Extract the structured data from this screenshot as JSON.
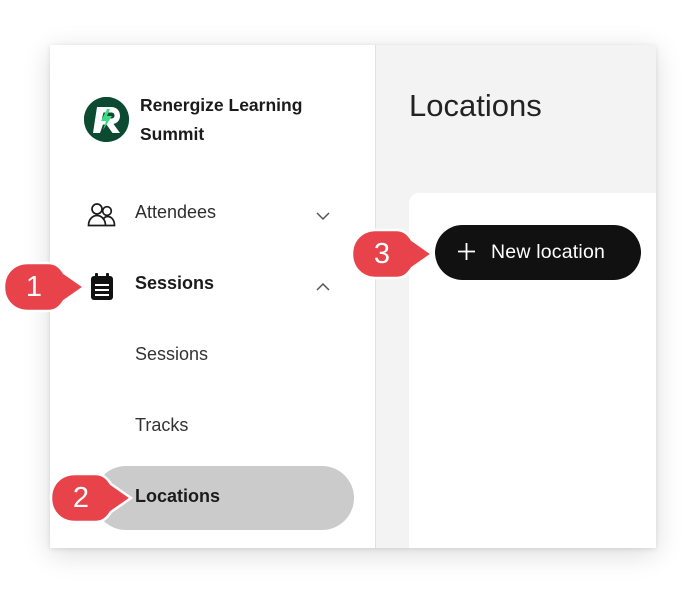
{
  "app": {
    "name": "Renergize Learning Summit"
  },
  "sidebar": {
    "attendees": {
      "label": "Attendees",
      "icon": "people-icon",
      "expanded": false
    },
    "sessions": {
      "label": "Sessions",
      "icon": "calendar-icon",
      "expanded": true,
      "sub_items": [
        {
          "label": "Sessions",
          "active": false
        },
        {
          "label": "Tracks",
          "active": false
        },
        {
          "label": "Locations",
          "active": true
        }
      ]
    }
  },
  "main": {
    "title": "Locations",
    "new_button": {
      "label": "New location",
      "icon": "plus-icon"
    }
  },
  "callouts": [
    "1",
    "2",
    "3"
  ],
  "colors": {
    "brand_logo": "#0c4a32",
    "button_bg": "#111111",
    "active_pill": "#cbcbcb",
    "callout_red": "#e8434a",
    "main_bg": "#f3f3f3"
  }
}
